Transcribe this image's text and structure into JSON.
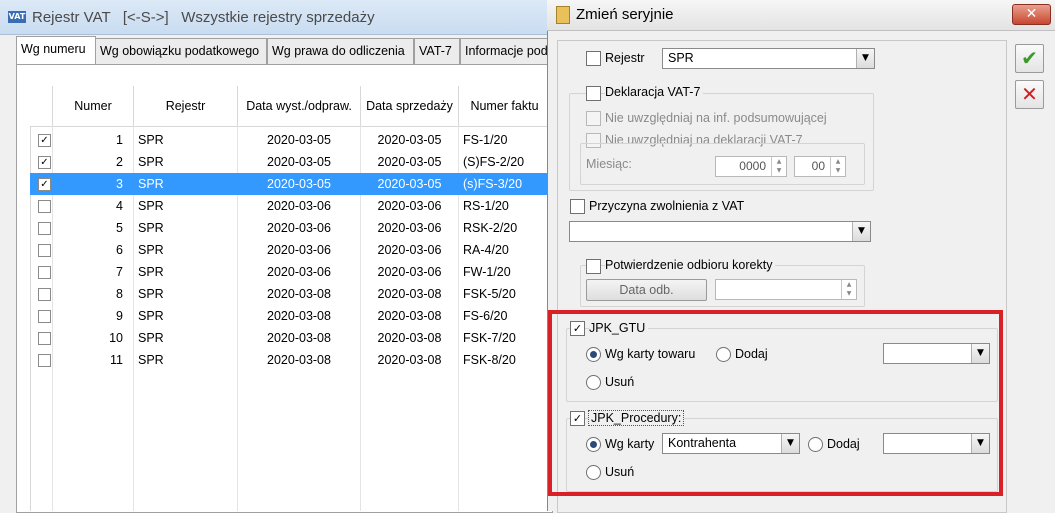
{
  "main_window": {
    "app_icon_text": "VAT",
    "title": "Rejestr VAT   [<-S->]   Wszystkie rejestry sprzedaży",
    "tabs": [
      {
        "label": "Wg numeru"
      },
      {
        "label": "Wg obowiązku podatkowego"
      },
      {
        "label": "Wg prawa do odliczenia"
      },
      {
        "label": "VAT-7"
      },
      {
        "label": "Informacje pod"
      }
    ],
    "columns": [
      "Numer",
      "Rejestr",
      "Data wyst./odpraw.",
      "Data sprzedaży",
      "Numer faktu"
    ],
    "rows": [
      {
        "checked": true,
        "num": "1",
        "reg": "SPR",
        "issued": "2020-03-05",
        "sale": "2020-03-05",
        "doc": "FS-1/20"
      },
      {
        "checked": true,
        "num": "2",
        "reg": "SPR",
        "issued": "2020-03-05",
        "sale": "2020-03-05",
        "doc": "(S)FS-2/20"
      },
      {
        "checked": true,
        "num": "3",
        "reg": "SPR",
        "issued": "2020-03-05",
        "sale": "2020-03-05",
        "doc": "(s)FS-3/20",
        "selected": true
      },
      {
        "checked": false,
        "num": "4",
        "reg": "SPR",
        "issued": "2020-03-06",
        "sale": "2020-03-06",
        "doc": "RS-1/20"
      },
      {
        "checked": false,
        "num": "5",
        "reg": "SPR",
        "issued": "2020-03-06",
        "sale": "2020-03-06",
        "doc": "RSK-2/20"
      },
      {
        "checked": false,
        "num": "6",
        "reg": "SPR",
        "issued": "2020-03-06",
        "sale": "2020-03-06",
        "doc": "RA-4/20"
      },
      {
        "checked": false,
        "num": "7",
        "reg": "SPR",
        "issued": "2020-03-06",
        "sale": "2020-03-06",
        "doc": "FW-1/20"
      },
      {
        "checked": false,
        "num": "8",
        "reg": "SPR",
        "issued": "2020-03-08",
        "sale": "2020-03-08",
        "doc": "FSK-5/20"
      },
      {
        "checked": false,
        "num": "9",
        "reg": "SPR",
        "issued": "2020-03-08",
        "sale": "2020-03-08",
        "doc": "FS-6/20"
      },
      {
        "checked": false,
        "num": "10",
        "reg": "SPR",
        "issued": "2020-03-08",
        "sale": "2020-03-08",
        "doc": "FSK-7/20"
      },
      {
        "checked": false,
        "num": "11",
        "reg": "SPR",
        "issued": "2020-03-08",
        "sale": "2020-03-08",
        "doc": "FSK-8/20"
      }
    ]
  },
  "dialog": {
    "title": "Zmień seryjnie",
    "close_glyph": "✕",
    "ok_glyph": "✔",
    "cancel_glyph": "✕",
    "rejestr": {
      "label": "Rejestr",
      "value": "SPR",
      "checked": false
    },
    "deklaracja": {
      "label": "Deklaracja VAT-7",
      "checked": false
    },
    "nie_inf": {
      "label": "Nie uwzględniaj na inf. podsumowującej"
    },
    "nie_dekl": {
      "label": "Nie uwzględniaj na deklaracji VAT-7"
    },
    "miesiac": {
      "label": "Miesiąc:",
      "year": "0000",
      "month": "00"
    },
    "przyczyna": {
      "label": "Przyczyna zwolnienia z VAT",
      "value": ""
    },
    "potwierdzenie": {
      "label": "Potwierdzenie odbioru korekty",
      "data_odb_label": "Data odb.",
      "data_odb_value": ""
    },
    "jpk_gtu": {
      "label": "JPK_GTU",
      "checked": true,
      "opt_wg": "Wg karty towaru",
      "opt_dodaj": "Dodaj",
      "opt_usun": "Usuń",
      "dodaj_value": ""
    },
    "jpk_proc": {
      "label": "JPK_Procedury:",
      "checked": true,
      "opt_wg": "Wg karty",
      "wg_value": "Kontrahenta",
      "opt_dodaj": "Dodaj",
      "opt_usun": "Usuń",
      "dodaj_value": ""
    },
    "highlight_color": "#d92027"
  }
}
